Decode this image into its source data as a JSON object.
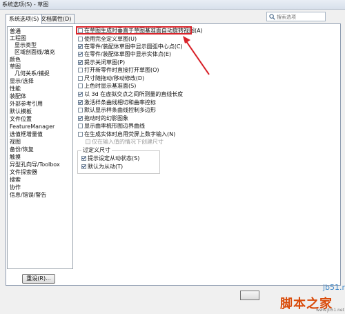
{
  "window": {
    "title": "系统选项(S) - 草图"
  },
  "tabs": [
    {
      "label": "系统选项(S)",
      "active": true
    },
    {
      "label": "文档属性(D)",
      "active": false
    }
  ],
  "search": {
    "placeholder": "搜索选项"
  },
  "tree": {
    "items": [
      {
        "label": "普通",
        "level": 0
      },
      {
        "label": "工程图",
        "level": 0
      },
      {
        "label": "显示类型",
        "level": 1
      },
      {
        "label": "区域剖面线/填充",
        "level": 1
      },
      {
        "label": "颜色",
        "level": 0
      },
      {
        "label": "草图",
        "level": 0
      },
      {
        "label": "几何关系/捕捉",
        "level": 1
      },
      {
        "label": "显示/选择",
        "level": 0
      },
      {
        "label": "性能",
        "level": 0
      },
      {
        "label": "装配体",
        "level": 0
      },
      {
        "label": "外部参考引用",
        "level": 0
      },
      {
        "label": "默认模板",
        "level": 0
      },
      {
        "label": "文件位置",
        "level": 0
      },
      {
        "label": "FeatureManager",
        "level": 0
      },
      {
        "label": "选值框增量值",
        "level": 0
      },
      {
        "label": "视图",
        "level": 0
      },
      {
        "label": "备份/恢复",
        "level": 0
      },
      {
        "label": "触摸",
        "level": 0
      },
      {
        "label": "异型孔向导/Toolbox",
        "level": 0
      },
      {
        "label": "文件探索器",
        "level": 0
      },
      {
        "label": "搜索",
        "level": 0
      },
      {
        "label": "协作",
        "level": 0
      },
      {
        "label": "信息/错误/警告",
        "level": 0
      }
    ]
  },
  "reset_button": {
    "label": "重设(R)..."
  },
  "options": [
    {
      "label": "在草图生成时垂直于草图基准面自动旋转视图(A)",
      "checked": false,
      "indent": 0
    },
    {
      "label": "使用完全定义草图(U)",
      "checked": false,
      "indent": 0
    },
    {
      "label": "在零件/装配体草图中显示圆弧中心点(C)",
      "checked": true,
      "indent": 0
    },
    {
      "label": "在零件/装配体草图中显示实体点(E)",
      "checked": true,
      "indent": 0
    },
    {
      "label": "提示关闭草图(P)",
      "checked": true,
      "indent": 0
    },
    {
      "label": "打开新零件时直接打开草图(O)",
      "checked": false,
      "indent": 0
    },
    {
      "label": "尺寸随拖动/移动修改(D)",
      "checked": false,
      "indent": 0
    },
    {
      "label": "上色时显示基准面(S)",
      "checked": false,
      "indent": 0
    },
    {
      "label": "以 3d 在虚拟交点之间所测量的直线长度",
      "checked": true,
      "indent": 0
    },
    {
      "label": "激活样条曲线相切和曲率控标",
      "checked": true,
      "indent": 0
    },
    {
      "label": "默认显示样条曲线控制多边形",
      "checked": false,
      "indent": 0
    },
    {
      "label": "拖动时的幻影图象",
      "checked": true,
      "indent": 0
    },
    {
      "label": "显示曲率梳形图边界曲线",
      "checked": false,
      "indent": 0
    },
    {
      "label": "在生成实体时启用荧屏上数字输入(N)",
      "checked": false,
      "indent": 0
    },
    {
      "label": "仅在输入值的情况下创建尺寸",
      "checked": false,
      "indent": 1,
      "disabled": true
    }
  ],
  "overdefined_group": {
    "title": "过定义尺寸",
    "options": [
      {
        "label": "提示设定从动状态(S)",
        "checked": true
      },
      {
        "label": "默认为从动(T)",
        "checked": true
      }
    ]
  },
  "watermark": {
    "top": "jb51.net",
    "bottom": "脚本之家",
    "url": "www.jb51.net"
  },
  "colors": {
    "highlight": "#d8232a",
    "arrow": "#d8232a"
  },
  "icons": {
    "search": "magnifier-icon"
  }
}
